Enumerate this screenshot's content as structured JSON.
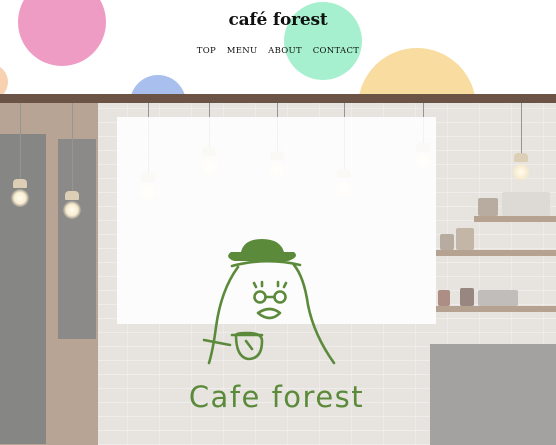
{
  "header": {
    "logo": "café forest",
    "nav": [
      "TOP",
      "MENU",
      "ABOUT",
      "CONTACT"
    ]
  },
  "hero": {
    "brand_text": "Cafe forest",
    "brand_color": "#5b8a3a"
  },
  "colors": {
    "dot_pink": "#ef9cc4",
    "dot_mint": "#a6f0cf",
    "dot_yellow": "#f8dca0",
    "dot_blue": "#a9bfee"
  }
}
